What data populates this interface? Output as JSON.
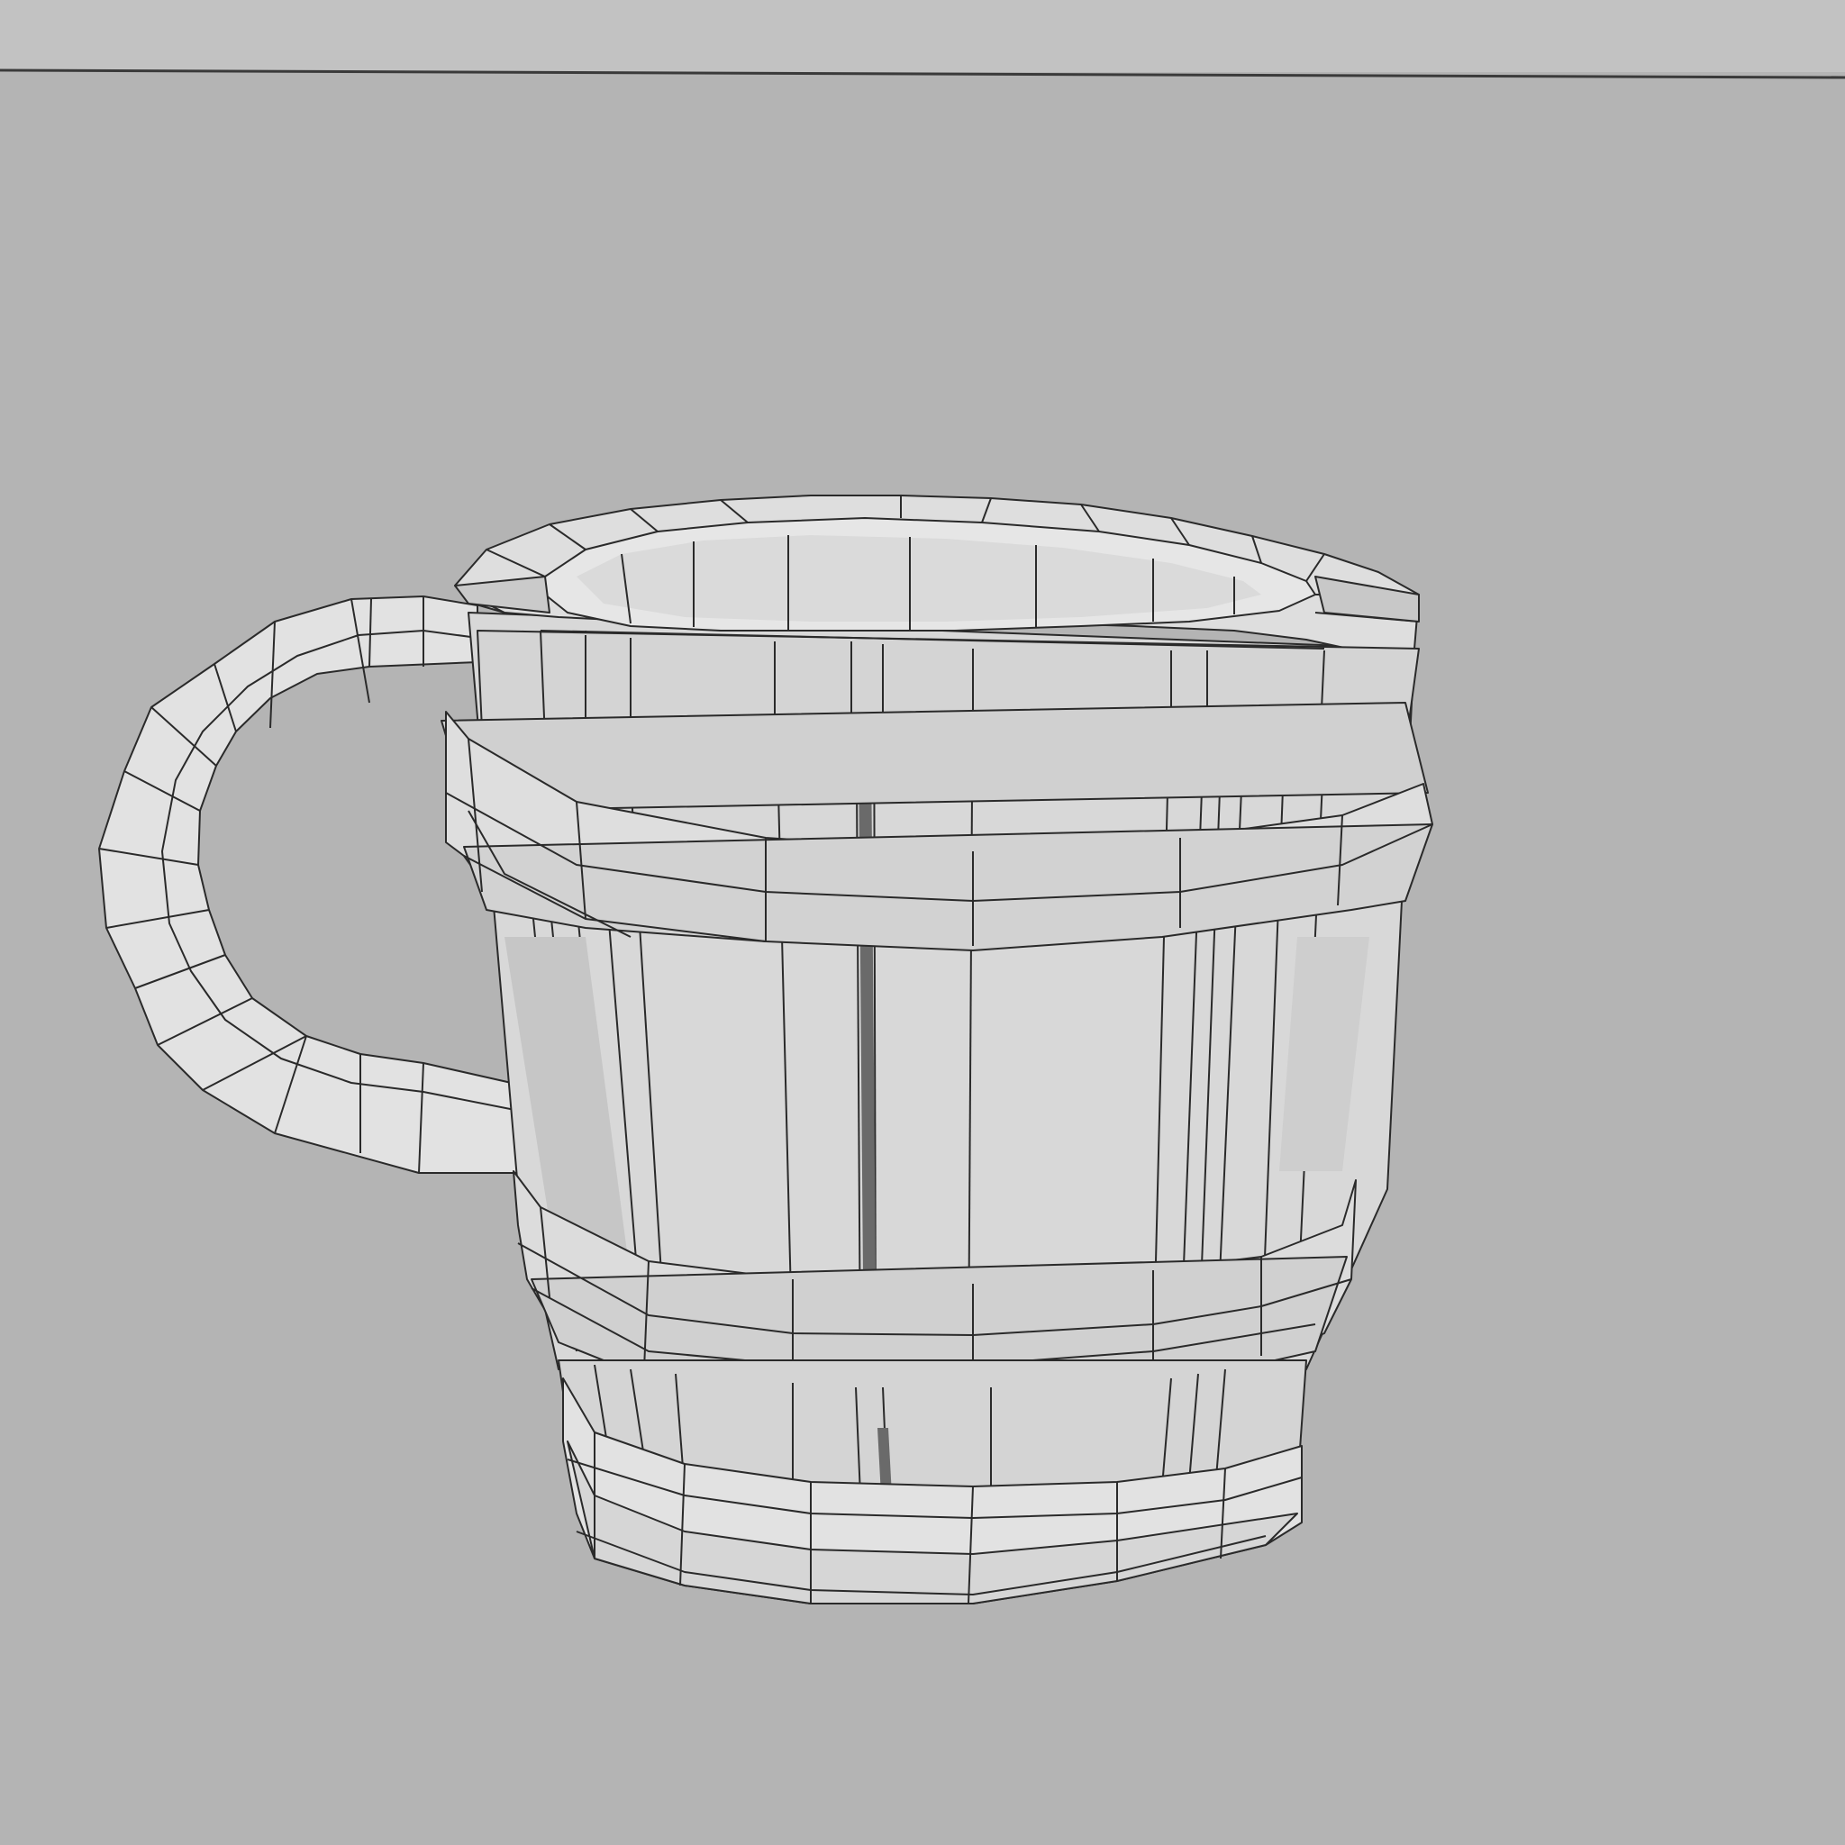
{
  "viewport": {
    "background_color": "#b4b4b4",
    "horizon_line_color": "#3a3a3a",
    "model_fill": "#dcdcdc",
    "model_fill_light": "#e8e8e8",
    "model_fill_shadow": "#c8c8c8",
    "wire_color": "#2a2a2a"
  },
  "model": {
    "icon": "wireframe-mug-icon",
    "parts": [
      "handle",
      "rim",
      "upper-band",
      "body-staves",
      "lower-band",
      "base"
    ]
  }
}
